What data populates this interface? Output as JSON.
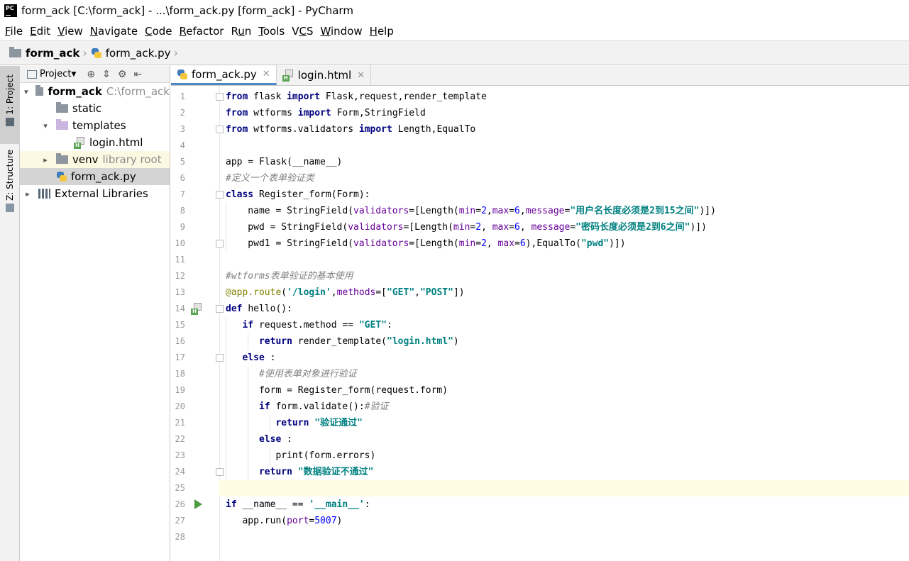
{
  "window": {
    "title": "form_ack [C:\\form_ack] - ...\\form_ack.py [form_ack] - PyCharm",
    "logo": "PC"
  },
  "menu": [
    {
      "label": "File",
      "mn": "F",
      "rest": "ile"
    },
    {
      "label": "Edit",
      "mn": "E",
      "rest": "dit"
    },
    {
      "label": "View",
      "mn": "V",
      "rest": "iew"
    },
    {
      "label": "Navigate",
      "mn": "N",
      "rest": "avigate"
    },
    {
      "label": "Code",
      "mn": "C",
      "rest": "ode"
    },
    {
      "label": "Refactor",
      "mn": "R",
      "rest": "efactor"
    },
    {
      "label": "Run",
      "pre": "R",
      "mn": "u",
      "rest": "n"
    },
    {
      "label": "Tools",
      "mn": "T",
      "rest": "ools"
    },
    {
      "label": "VCS",
      "pre": "V",
      "mn": "C",
      "rest": "S"
    },
    {
      "label": "Window",
      "mn": "W",
      "rest": "indow"
    },
    {
      "label": "Help",
      "mn": "H",
      "rest": "elp"
    }
  ],
  "breadcrumb": {
    "project": "form_ack",
    "file": "form_ack.py"
  },
  "side_tabs": {
    "project": "1: Project",
    "structure": "Z: Structure"
  },
  "project_panel": {
    "view_label": "Project",
    "tree": [
      {
        "label": "form_ack",
        "suffix": "C:\\form_ack",
        "depth": 0,
        "arrow": "down",
        "icon": "folder",
        "bold": true
      },
      {
        "label": "static",
        "depth": 1,
        "arrow": "",
        "icon": "folder"
      },
      {
        "label": "templates",
        "depth": 1,
        "arrow": "down",
        "icon": "folder-light"
      },
      {
        "label": "login.html",
        "depth": 2,
        "arrow": "",
        "icon": "html-icon"
      },
      {
        "label": "venv",
        "suffix": "library root",
        "depth": 1,
        "arrow": "right",
        "icon": "folder",
        "venv": true
      },
      {
        "label": "form_ack.py",
        "depth": 1,
        "arrow": "",
        "icon": "python-icon",
        "selected": true
      },
      {
        "label": "External Libraries",
        "depth": 0,
        "arrow": "right",
        "icon": "library-icon"
      }
    ]
  },
  "tabs": [
    {
      "label": "form_ack.py",
      "icon": "python-icon",
      "active": true
    },
    {
      "label": "login.html",
      "icon": "html-icon",
      "active": false
    }
  ],
  "current_line": 25,
  "code_lines": [
    [
      [
        "kw",
        "from"
      ],
      [
        "",
        "flask "
      ],
      [
        "kw",
        "import"
      ],
      [
        "",
        "Flask,request,render_template"
      ]
    ],
    [
      [
        "kw",
        "from"
      ],
      [
        "",
        "wtforms "
      ],
      [
        "kw",
        "import"
      ],
      [
        "",
        "Form,StringField"
      ]
    ],
    [
      [
        "kw",
        "from"
      ],
      [
        "",
        "wtforms.validators "
      ],
      [
        "kw",
        "import"
      ],
      [
        "",
        "Length,EqualTo"
      ]
    ],
    [],
    [
      [
        "",
        "app = Flask(__name__)"
      ]
    ],
    [
      [
        "cm",
        "#定义一个表单验证类"
      ]
    ],
    [
      [
        "kw",
        "class"
      ],
      [
        "",
        "Register_form(Form):"
      ]
    ],
    [
      [
        "",
        "    name = StringField("
      ],
      [
        "pr",
        "validators"
      ],
      [
        "",
        "=[Length("
      ],
      [
        "pr",
        "min"
      ],
      [
        "",
        "="
      ],
      [
        "nm",
        "2"
      ],
      [
        "",
        ","
      ],
      [
        "pr",
        "max"
      ],
      [
        "",
        "="
      ],
      [
        "nm",
        "6"
      ],
      [
        "",
        ","
      ],
      [
        "pr",
        "message"
      ],
      [
        "",
        "="
      ],
      [
        "st",
        "\"用户名长度必须是2到15之间\""
      ],
      [
        "",
        ")])"
      ]
    ],
    [
      [
        "",
        "    pwd = StringField("
      ],
      [
        "pr",
        "validators"
      ],
      [
        "",
        "=[Length("
      ],
      [
        "pr",
        "min"
      ],
      [
        "",
        "="
      ],
      [
        "nm",
        "2"
      ],
      [
        "",
        ", "
      ],
      [
        "pr",
        "max"
      ],
      [
        "",
        "="
      ],
      [
        "nm",
        "6"
      ],
      [
        "",
        ", "
      ],
      [
        "pr",
        "message"
      ],
      [
        "",
        "="
      ],
      [
        "st",
        "\"密码长度必须是2到6之间\""
      ],
      [
        "",
        ")])"
      ]
    ],
    [
      [
        "",
        "    pwd1 = StringField("
      ],
      [
        "pr",
        "validators"
      ],
      [
        "",
        "=[Length("
      ],
      [
        "pr",
        "min"
      ],
      [
        "",
        "="
      ],
      [
        "nm",
        "2"
      ],
      [
        "",
        ", "
      ],
      [
        "pr",
        "max"
      ],
      [
        "",
        "="
      ],
      [
        "nm",
        "6"
      ],
      [
        "",
        "),EqualTo("
      ],
      [
        "st",
        "\"pwd\""
      ],
      [
        "",
        ")])"
      ]
    ],
    [],
    [
      [
        "cm",
        "#wtforms表单验证的基本使用"
      ]
    ],
    [
      [
        "dec",
        "@app.route"
      ],
      [
        "",
        "("
      ],
      [
        "st",
        "'/login'"
      ],
      [
        "",
        ","
      ],
      [
        "pr",
        "methods"
      ],
      [
        "",
        "=["
      ],
      [
        "st",
        "\"GET\""
      ],
      [
        "",
        ","
      ],
      [
        "st",
        "\"POST\""
      ],
      [
        "",
        "])"
      ]
    ],
    [
      [
        "kw",
        "def"
      ],
      [
        "",
        "hello():"
      ]
    ],
    [
      [
        "",
        "   "
      ],
      [
        "kw",
        "if"
      ],
      [
        "",
        "request.method == "
      ],
      [
        "st",
        "\"GET\""
      ],
      [
        "",
        ":"
      ]
    ],
    [
      [
        "",
        "      "
      ],
      [
        "kw",
        "return"
      ],
      [
        "",
        "render_template("
      ],
      [
        "st",
        "\"login.html\""
      ],
      [
        "",
        ")"
      ]
    ],
    [
      [
        "",
        "   "
      ],
      [
        "kw",
        "else"
      ],
      [
        "",
        ":"
      ]
    ],
    [
      [
        "",
        "      "
      ],
      [
        "cm",
        "#使用表单对象进行验证"
      ]
    ],
    [
      [
        "",
        "      form = Register_form(request.form)"
      ]
    ],
    [
      [
        "",
        "      "
      ],
      [
        "kw",
        "if"
      ],
      [
        "",
        "form.validate():"
      ],
      [
        "cm",
        "#验证"
      ]
    ],
    [
      [
        "",
        "         "
      ],
      [
        "kw",
        "return"
      ],
      [
        "",
        ""
      ],
      [
        "st",
        "\"验证通过\""
      ]
    ],
    [
      [
        "",
        "      "
      ],
      [
        "kw",
        "else"
      ],
      [
        "",
        ":"
      ]
    ],
    [
      [
        "",
        "         print(form.errors)"
      ]
    ],
    [
      [
        "",
        "      "
      ],
      [
        "kw",
        "return"
      ],
      [
        "",
        ""
      ],
      [
        "st",
        "\"数据验证不通过\""
      ]
    ],
    [],
    [
      [
        "kw",
        "if"
      ],
      [
        "",
        "__name__ == "
      ],
      [
        "st",
        "'__main__'"
      ],
      [
        "",
        ":"
      ]
    ],
    [
      [
        "",
        "   app.run("
      ],
      [
        "pr",
        "port"
      ],
      [
        "",
        "="
      ],
      [
        "nm",
        "5007"
      ],
      [
        "",
        ")"
      ]
    ],
    []
  ]
}
